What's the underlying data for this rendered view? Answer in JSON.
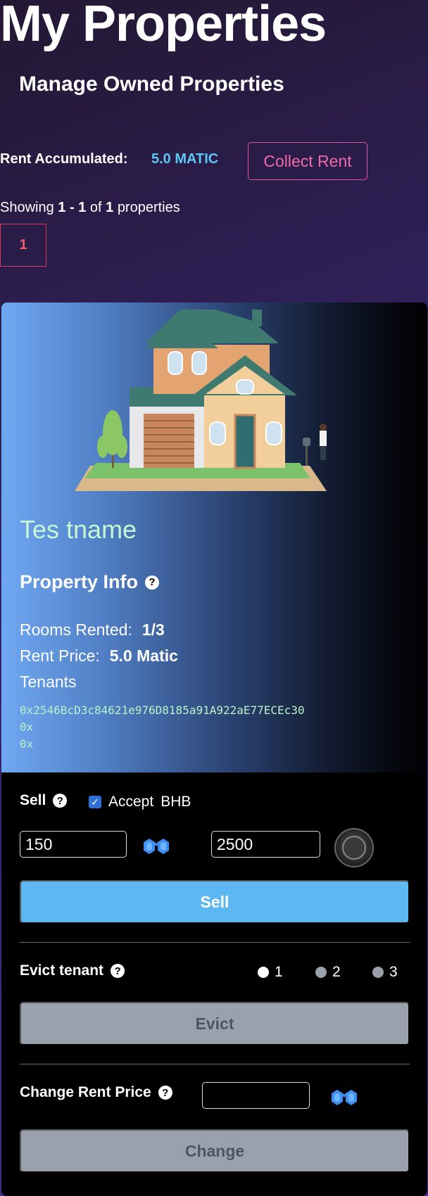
{
  "header": {
    "title": "My Properties",
    "subtitle": "Manage Owned Properties"
  },
  "rent": {
    "label": "Rent Accumulated:",
    "value": "5.0 MATIC",
    "collect_label": "Collect Rent"
  },
  "pagination": {
    "showing_prefix": "Showing",
    "range": "1 - 1",
    "of": "of",
    "total": "1",
    "suffix": "properties",
    "current_page": "1"
  },
  "property": {
    "name": "Tes tname",
    "info_title": "Property Info",
    "rooms_label": "Rooms Rented:",
    "rooms_value": "1/3",
    "rent_label": "Rent Price:",
    "rent_value": "5.0 Matic",
    "tenants_label": "Tenants",
    "tenants": [
      "0x2546BcD3c84621e976D8185a91A922aE77ECEc30",
      "0x",
      "0x"
    ]
  },
  "sell": {
    "label": "Sell",
    "accept_label": "Accept",
    "accept_token": "BHB",
    "accept_checked": true,
    "matic_price": "150",
    "bhb_price": "2500",
    "button_label": "Sell"
  },
  "evict": {
    "label": "Evict tenant",
    "options": [
      "1",
      "2",
      "3"
    ],
    "selected": "1",
    "button_label": "Evict"
  },
  "change_rent": {
    "label": "Change Rent Price",
    "value": "",
    "button_label": "Change"
  },
  "icons": {
    "help": "question-circle-icon",
    "matic": "matic-logo-icon",
    "bhb": "bhb-coin-icon"
  },
  "colors": {
    "accent_blue": "#5db8f2",
    "collect_pink": "#f06aa9",
    "page_red": "#ef5b6e",
    "name_green": "#c6f7d4",
    "disabled_gray": "#9aa1ac"
  }
}
